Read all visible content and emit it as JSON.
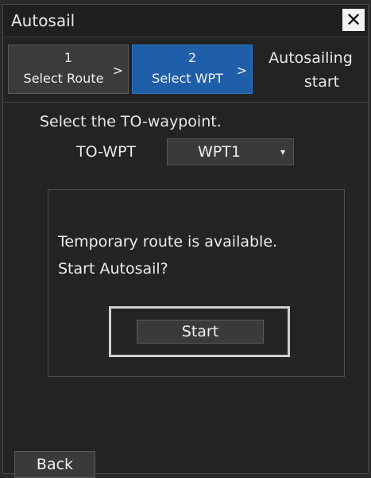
{
  "window": {
    "title": "Autosail",
    "close_glyph": "✕"
  },
  "steps": [
    {
      "number": "1",
      "label": "Select Route",
      "arrow": ">",
      "state": "done"
    },
    {
      "number": "2",
      "label": "Select WPT",
      "arrow": ">",
      "state": "active"
    },
    {
      "line1": "Autosailing",
      "line2": "start",
      "state": "pending"
    }
  ],
  "select_wpt": {
    "prompt": "Select the TO-waypoint.",
    "to_wpt_label": "TO-WPT",
    "selected_value": "WPT1",
    "caret": "▾"
  },
  "dialog": {
    "message_line1": "Temporary route is available.",
    "message_line2": "Start Autosail?",
    "start_label": "Start"
  },
  "footer": {
    "back_label": "Back"
  },
  "colors": {
    "active_step": "#1f5ea8",
    "background": "#232323"
  }
}
